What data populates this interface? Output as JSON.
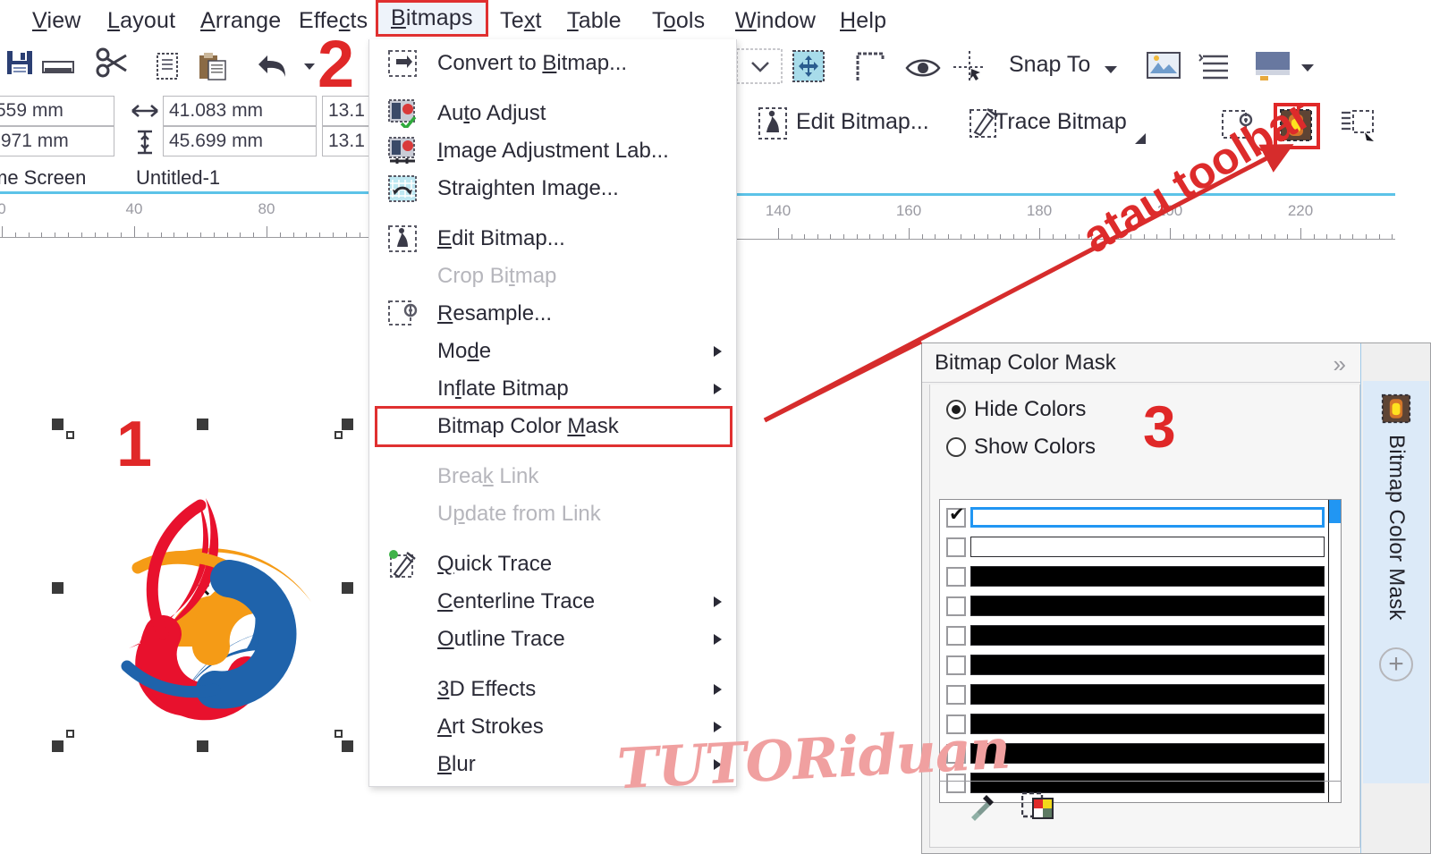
{
  "app": {
    "menubar": [
      {
        "label": "View",
        "accel": "V",
        "active": false
      },
      {
        "label": "Layout",
        "accel": "L",
        "active": false
      },
      {
        "label": "Arrange",
        "accel": "A",
        "active": false
      },
      {
        "label": "Effects",
        "accel": "c",
        "active": false
      },
      {
        "label": "Bitmaps",
        "accel": "B",
        "active": true
      },
      {
        "label": "Text",
        "accel": "x",
        "active": false
      },
      {
        "label": "Table",
        "accel": "T",
        "active": false
      },
      {
        "label": "Tools",
        "accel": "o",
        "active": false
      },
      {
        "label": "Window",
        "accel": "W",
        "active": false
      },
      {
        "label": "Help",
        "accel": "H",
        "active": false
      }
    ],
    "toolbar_top": [
      {
        "name": "save-icon"
      },
      {
        "name": "print-icon"
      },
      {
        "name": "cut-scissors-icon"
      },
      {
        "name": "copy-icon"
      },
      {
        "name": "paste-icon"
      },
      {
        "name": "undo-icon"
      },
      {
        "name": "undo-dropdown-icon"
      }
    ],
    "property_bar": {
      "x_value": "559 mm",
      "y_value": ".971 mm",
      "width_value": "41.083 mm",
      "height_value": "45.699 mm",
      "scale_x": "13.1",
      "scale_y": "13.1",
      "zoom_placeholder": "",
      "snap_to_label": "Snap To"
    },
    "bitmap_bar": {
      "edit_bitmap_label": "Edit Bitmap...",
      "trace_bitmap_label": "Trace Bitmap"
    },
    "tabs": [
      {
        "label": "me Screen"
      },
      {
        "label": "Untitled-1"
      }
    ],
    "rulers": {
      "top_left_labels": [
        "0",
        "40",
        "80"
      ],
      "top_right_labels": [
        "140",
        "160",
        "180",
        "200",
        "220"
      ]
    }
  },
  "bitmaps_menu": {
    "items": [
      {
        "label": "Convert to Bitmap...",
        "accel": "B",
        "icon": "convert-to-bitmap-icon",
        "disabled": false,
        "submenu": false
      },
      {
        "sep": true
      },
      {
        "label": "Auto Adjust",
        "accel": "t",
        "icon": "auto-adjust-icon",
        "disabled": false,
        "submenu": false
      },
      {
        "label": "Image Adjustment Lab...",
        "accel": "I",
        "icon": "image-adjustment-lab-icon",
        "disabled": false,
        "submenu": false
      },
      {
        "label": "Straighten Image...",
        "accel": "g",
        "icon": "straighten-image-icon",
        "disabled": false,
        "submenu": false
      },
      {
        "sep": true
      },
      {
        "label": "Edit Bitmap...",
        "accel": "E",
        "icon": "edit-bitmap-icon",
        "disabled": false,
        "submenu": false
      },
      {
        "label": "Crop Bitmap",
        "accel": "t",
        "icon": "",
        "disabled": true,
        "submenu": false
      },
      {
        "label": "Resample...",
        "accel": "R",
        "icon": "resample-icon",
        "disabled": false,
        "submenu": false
      },
      {
        "label": "Mode",
        "accel": "d",
        "icon": "",
        "disabled": false,
        "submenu": true
      },
      {
        "label": "Inflate Bitmap",
        "accel": "f",
        "icon": "",
        "disabled": false,
        "submenu": true
      },
      {
        "label": "Bitmap Color Mask",
        "accel": "M",
        "icon": "",
        "disabled": false,
        "submenu": false,
        "highlighted": true
      },
      {
        "sep": true
      },
      {
        "label": "Break Link",
        "accel": "k",
        "icon": "",
        "disabled": true,
        "submenu": false
      },
      {
        "label": "Update from Link",
        "accel": "p",
        "icon": "",
        "disabled": true,
        "submenu": false
      },
      {
        "sep": true
      },
      {
        "label": "Quick Trace",
        "accel": "Q",
        "icon": "quick-trace-icon",
        "disabled": false,
        "submenu": false
      },
      {
        "label": "Centerline Trace",
        "accel": "C",
        "icon": "",
        "disabled": false,
        "submenu": true
      },
      {
        "label": "Outline Trace",
        "accel": "O",
        "icon": "",
        "disabled": false,
        "submenu": true
      },
      {
        "sep": true
      },
      {
        "label": "3D Effects",
        "accel": "3",
        "icon": "",
        "disabled": false,
        "submenu": true
      },
      {
        "label": "Art Strokes",
        "accel": "A",
        "icon": "",
        "disabled": false,
        "submenu": true
      },
      {
        "label": "Blur",
        "accel": "B",
        "icon": "",
        "disabled": false,
        "submenu": true
      }
    ]
  },
  "docker": {
    "title": "Bitmap Color Mask",
    "collapse_icon": "collapse-chevrons-icon",
    "close_icon": "close-icon",
    "mode_options": [
      {
        "label": "Hide Colors",
        "selected": true
      },
      {
        "label": "Show Colors",
        "selected": false
      }
    ],
    "color_rows": [
      {
        "checked": true,
        "color": "#ffffff",
        "selected": true
      },
      {
        "checked": false,
        "color": "#ffffff",
        "selected": false
      },
      {
        "checked": false,
        "color": "#000000",
        "selected": false
      },
      {
        "checked": false,
        "color": "#000000",
        "selected": false
      },
      {
        "checked": false,
        "color": "#000000",
        "selected": false
      },
      {
        "checked": false,
        "color": "#000000",
        "selected": false
      },
      {
        "checked": false,
        "color": "#000000",
        "selected": false
      },
      {
        "checked": false,
        "color": "#000000",
        "selected": false
      },
      {
        "checked": false,
        "color": "#000000",
        "selected": false
      },
      {
        "checked": false,
        "color": "#000000",
        "selected": false
      }
    ],
    "footer_tools": [
      {
        "name": "eyedropper-icon"
      },
      {
        "name": "select-color-icon"
      }
    ],
    "side_tab_label": "Bitmap Color Mask",
    "side_tab_icon": "bitmap-color-mask-icon",
    "add_docker_icon": "plus-circle-icon"
  },
  "annotations": {
    "step1": "1",
    "step2": "2",
    "step3": "3",
    "callout": "atau toolbar",
    "accent_red": "#dd2b2b"
  },
  "canvas": {
    "watermark": "TUTORiduan",
    "logo": {
      "name": "tri-swirl-logo",
      "colors": {
        "red": "#e8112d",
        "orange": "#f59b16",
        "blue": "#1f63ab"
      }
    },
    "center_marker": "×"
  }
}
